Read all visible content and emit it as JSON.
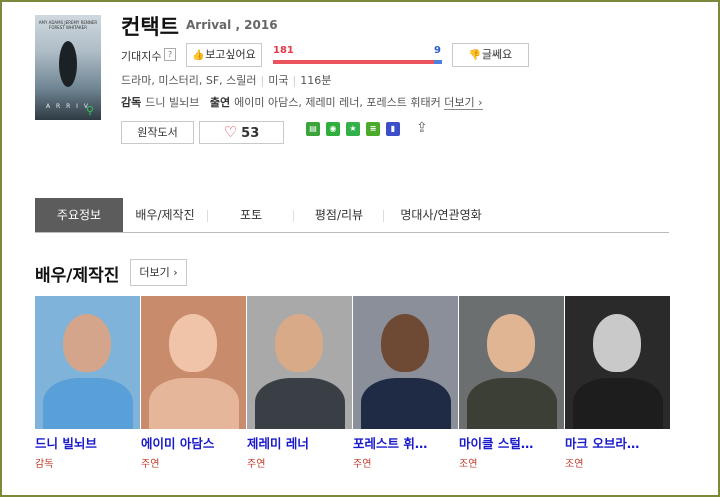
{
  "movie": {
    "title": "컨택트",
    "subtitle": "Arrival , 2016",
    "poster_title_text": "A R R I V",
    "poster_top_text": "AMY ADAMS  JEREMY RENNER  FOREST WHITAKER",
    "expectation_label": "기대지수",
    "help_icon": "?",
    "want_button": "보고싶어요",
    "dislike_button": "글쎄요",
    "want_count": "181",
    "dislike_count": "9",
    "want_ratio": 0.95,
    "genres": [
      "드라마",
      "미스터리",
      "SF",
      "스릴러"
    ],
    "country": "미국",
    "runtime": "116분",
    "director_label": "감독",
    "director": "드니 빌뇌브",
    "cast_label": "출연",
    "cast": "에이미 아담스, 제레미 레너, 포레스트 휘태커",
    "more_link": "더보기 ›",
    "book_button": "원작도서",
    "like_count": "53"
  },
  "services": [
    {
      "name": "service-icon-1",
      "color": "#3aa33a",
      "glyph": "▤"
    },
    {
      "name": "service-icon-2",
      "color": "#2fae3c",
      "glyph": "◉"
    },
    {
      "name": "service-icon-3",
      "color": "#33b04a",
      "glyph": "★"
    },
    {
      "name": "service-icon-4",
      "color": "#4caa2a",
      "glyph": "≡"
    },
    {
      "name": "service-icon-5",
      "color": "#3c4fc9",
      "glyph": "▮"
    }
  ],
  "tabs": [
    "주요정보",
    "배우/제작진",
    "포토",
    "평점/리뷰",
    "명대사/연관영화"
  ],
  "section": {
    "title": "배우/제작진",
    "more_button": "더보기 ›"
  },
  "people": [
    {
      "name": "드니 빌뇌브",
      "role": "감독",
      "bg": "#7fb3d9",
      "skin": "#d4a58a",
      "cloth": "#5aa0d8"
    },
    {
      "name": "에이미 아담스",
      "role": "주연",
      "bg": "#c88b6b",
      "skin": "#f0c4a8",
      "cloth": "#e6b69a"
    },
    {
      "name": "제레미 레너",
      "role": "주연",
      "bg": "#a9a9a9",
      "skin": "#d9aa88",
      "cloth": "#3a3f45"
    },
    {
      "name": "포레스트 휘…",
      "role": "주연",
      "bg": "#8a8f99",
      "skin": "#6e4a35",
      "cloth": "#1f2a44"
    },
    {
      "name": "마이클 스털…",
      "role": "조연",
      "bg": "#6b6f6f",
      "skin": "#e0b594",
      "cloth": "#3c3f36"
    },
    {
      "name": "마크 오브라…",
      "role": "조연",
      "bg": "#2a2a2a",
      "skin": "#c9c9c9",
      "cloth": "#1d1d1d"
    }
  ],
  "colors": {
    "want": "#e9545e",
    "dislike": "#4d7fe0",
    "active_tab": "#5c5c5c",
    "name_link": "#1a1acc",
    "role": "#c0392b",
    "frame": "#7b8a3a"
  }
}
